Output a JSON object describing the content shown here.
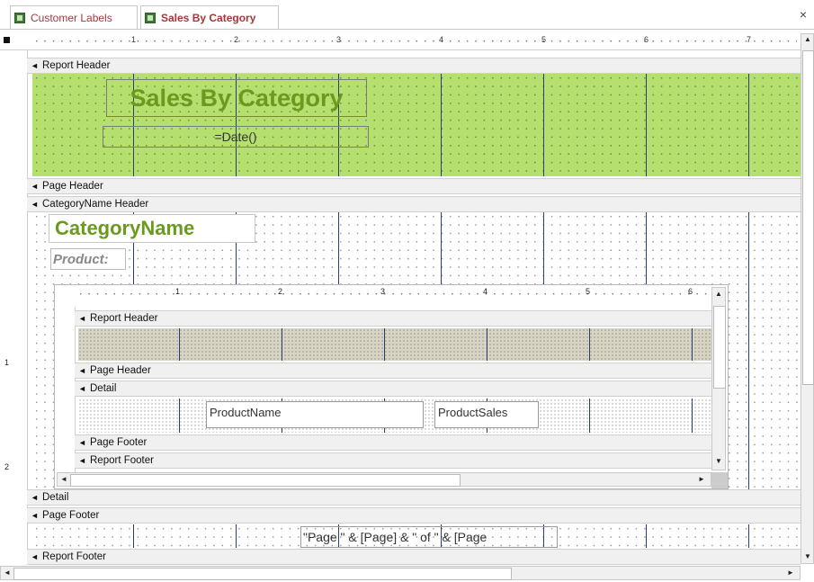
{
  "tabs": [
    {
      "label": "Customer Labels",
      "active": false
    },
    {
      "label": "Sales By Category",
      "active": true
    }
  ],
  "close_glyph": "×",
  "main_ruler": {
    "numbers": [
      "1",
      "2",
      "3",
      "4",
      "5",
      "6",
      "7"
    ],
    "vertical_numbers": [
      "1",
      "2"
    ]
  },
  "sections": {
    "report_header": "Report Header",
    "page_header": "Page Header",
    "category_header": "CategoryName Header",
    "detail": "Detail",
    "page_footer": "Page Footer",
    "report_footer": "Report Footer"
  },
  "controls": {
    "title": "Sales By Category",
    "date": "=Date()",
    "category_name": "CategoryName",
    "product_label": "Product:",
    "page_expr": "\"Page \" & [Page] & \" of \" & [Page"
  },
  "subreport": {
    "ruler_numbers": [
      "1",
      "2",
      "3",
      "4",
      "5",
      "6"
    ],
    "sections": {
      "report_header": "Report Header",
      "page_header": "Page Header",
      "detail": "Detail",
      "page_footer": "Page Footer",
      "report_footer": "Report Footer"
    },
    "fields": {
      "product_name": "ProductName",
      "product_sales": "ProductSales"
    }
  },
  "colors": {
    "report_header_bg": "#b5e06f",
    "title_text": "#6a9a1e",
    "subreport_header_bg": "#d8d4c4",
    "tab_text": "#a4373a"
  },
  "icons": [
    "table-icon",
    "collapse-arrow-icon",
    "scroll-up-icon",
    "scroll-down-icon",
    "scroll-left-icon",
    "scroll-right-icon",
    "close-icon"
  ]
}
